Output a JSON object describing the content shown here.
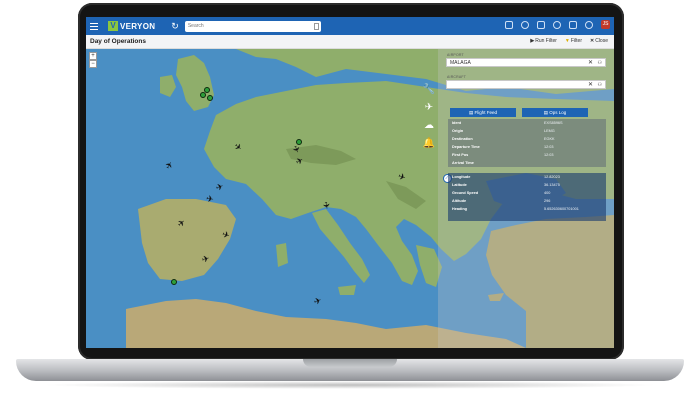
{
  "app": {
    "logo_text": "VERYON",
    "logo_mark": "V",
    "search_placeholder": "Search",
    "avatar_initials": "JS"
  },
  "header": {
    "page_title": "Day of Operations",
    "actions": [
      {
        "icon": "play-icon",
        "label": "Run Filter"
      },
      {
        "icon": "filter-icon",
        "label": "Filter"
      },
      {
        "icon": "close-icon",
        "label": "Close"
      }
    ]
  },
  "map": {
    "zoom_in": "+",
    "zoom_out": "−"
  },
  "panel": {
    "airport_label": "AIRPORT",
    "airport_value": "MALAGA",
    "aircraft_label": "AIRCRAFT",
    "aircraft_value": "",
    "flight_feed_label": "Flight Feed",
    "ops_log_label": "Ops Log",
    "flight_rows": [
      {
        "key": "Ident",
        "value": "EXS8596S"
      },
      {
        "key": "Origin",
        "value": "LEMG"
      },
      {
        "key": "Destination",
        "value": "EGKK"
      },
      {
        "key": "Departure Time",
        "value": "12:03"
      },
      {
        "key": "First Pos",
        "value": "12:03"
      },
      {
        "key": "Arrival Time",
        "value": ""
      }
    ],
    "position_rows": [
      {
        "key": "Longitude",
        "value": "12.82023"
      },
      {
        "key": "Latitude",
        "value": "36.13475"
      },
      {
        "key": "Ground Speed",
        "value": "400"
      },
      {
        "key": "Altitude",
        "value": "296"
      },
      {
        "key": "Heading",
        "value": "5.652630600701001"
      }
    ]
  },
  "colors": {
    "brand_blue": "#1e64b4",
    "logo_green": "#8cc63f",
    "sea": "#4a8fc4",
    "land": "#8fae6b",
    "marker_green": "#2e9e3a",
    "avatar_red": "#c0392b"
  }
}
